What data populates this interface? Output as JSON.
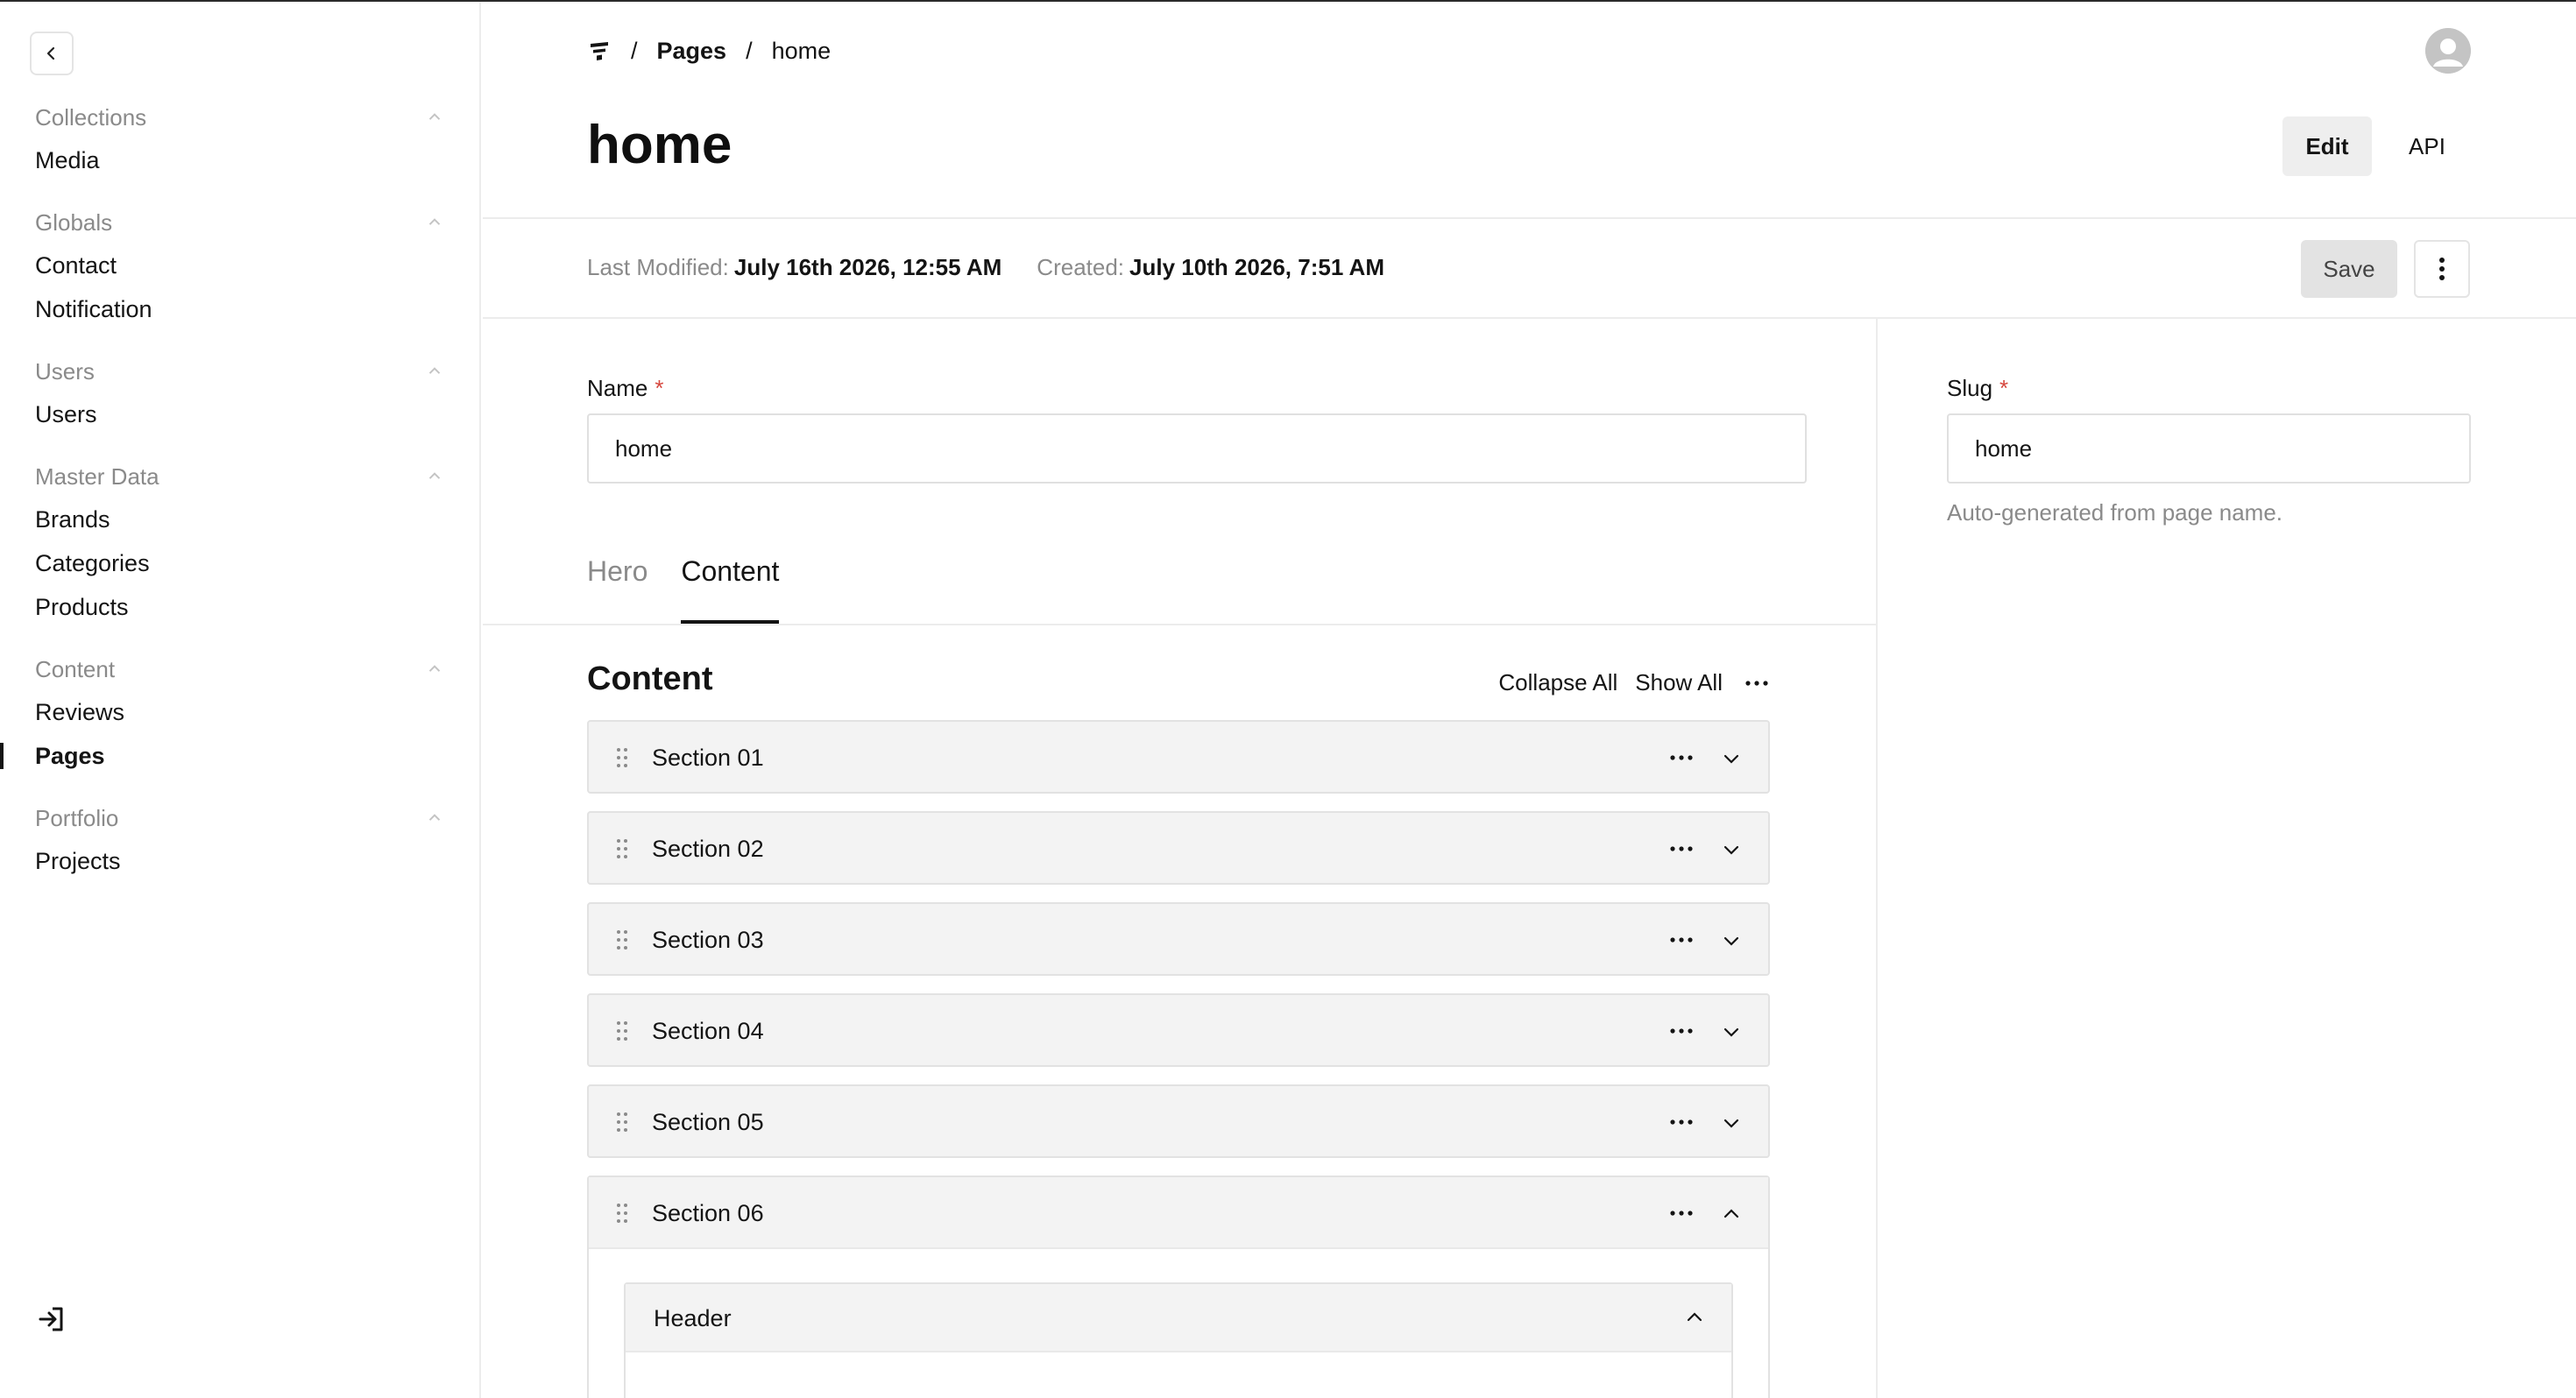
{
  "sidebar": {
    "groups": [
      {
        "label": "Collections",
        "items": [
          "Media"
        ]
      },
      {
        "label": "Globals",
        "items": [
          "Contact",
          "Notification"
        ]
      },
      {
        "label": "Users",
        "items": [
          "Users"
        ]
      },
      {
        "label": "Master Data",
        "items": [
          "Brands",
          "Categories",
          "Products"
        ]
      },
      {
        "label": "Content",
        "items": [
          "Reviews",
          "Pages"
        ]
      },
      {
        "label": "Portfolio",
        "items": [
          "Projects"
        ]
      }
    ],
    "active_item": "Pages"
  },
  "breadcrumb": {
    "separator": "/",
    "section": "Pages",
    "current": "home"
  },
  "header": {
    "title": "home",
    "edit_label": "Edit",
    "api_label": "API"
  },
  "meta": {
    "last_modified_label": "Last Modified:",
    "last_modified_value": "July 16th 2026, 12:55 AM",
    "created_label": "Created:",
    "created_value": "July 10th 2026, 7:51 AM",
    "save_label": "Save"
  },
  "fields": {
    "name": {
      "label": "Name",
      "required": "*",
      "value": "home"
    },
    "slug": {
      "label": "Slug",
      "required": "*",
      "value": "home",
      "hint": "Auto-generated from page name."
    }
  },
  "tabs": [
    {
      "label": "Hero",
      "active": false
    },
    {
      "label": "Content",
      "active": true
    }
  ],
  "content": {
    "title": "Content",
    "collapse_all": "Collapse All",
    "show_all": "Show All",
    "sections": [
      "Section 01",
      "Section 02",
      "Section 03",
      "Section 04",
      "Section 05",
      "Section 06"
    ],
    "open_section": "Section 06",
    "open_section_block": "Header"
  },
  "icons": {
    "back": "chevron-left-icon",
    "logo": "logo-icon",
    "avatar": "user-avatar-icon",
    "more": "vertical-dots-icon",
    "drag": "drag-handle-icon",
    "section_menu": "horizontal-dots-icon",
    "expand": "chevron-down-icon",
    "collapse": "chevron-up-icon",
    "logout": "logout-icon"
  }
}
